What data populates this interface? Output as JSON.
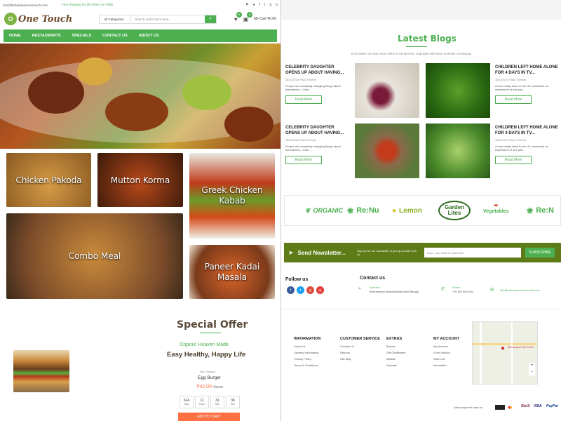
{
  "topbar": {
    "email": "info@behrampoieonetouch.com",
    "shipping": "Free Shipping for all Orders on ₹999"
  },
  "header": {
    "logo_small": "Behrampore",
    "logo_text": "One Touch",
    "search_category": "All Categories",
    "search_placeholder": "Search entire store here...",
    "wishlist_count": "0",
    "cart_count": "0",
    "cart_label": "My Cart ₹0.00"
  },
  "nav": [
    "HOME",
    "RESTAURANTS",
    "SPECIALS",
    "CONTACT US",
    "ABOUT US"
  ],
  "tiles": [
    "Chicken Pakoda",
    "Mutton Korma",
    "Greek Chicken Kabab",
    "Combo Meal",
    "Paneer Kadai Masala"
  ],
  "special": {
    "title": "Special Offer",
    "subtitle": "Organic Heaven Made",
    "tagline": "Easy Healthy, Happy Life",
    "category": "Hot Chicken",
    "product": "Egg Burger",
    "price": "₹42.00",
    "old_price": "₹62.00",
    "countdown": [
      {
        "v": "624",
        "l": "Day"
      },
      {
        "v": "11",
        "l": "Hour"
      },
      {
        "v": "31",
        "l": "Min"
      },
      {
        "v": "36",
        "l": "Sec"
      }
    ],
    "cta": "ADD TO CART"
  },
  "blogs": {
    "title": "Latest Blogs",
    "subtitle": "Duis autem vel eum iriure dolor in hendrerit in vulputate velit esse molestie consequat.",
    "posts": [
      {
        "title": "CELEBRITY DAUGHTER OPENS UP ABOUT HAVING...",
        "date": "18/10/2019",
        "author": "Plaza Themes",
        "excerpt": "People are constantly changing things about themselves— from...",
        "cta": "Read More"
      },
      {
        "title": "CHILDREN LEFT HOME ALONE FOR 4 DAYS IN TV...",
        "date": "18/10/2019",
        "author": "Plaza Themes",
        "excerpt": "A new reality show in the UK conducted an experiment to see just...",
        "cta": "Read More"
      },
      {
        "title": "CELEBRITY DAUGHTER OPENS UP ABOUT HAVING...",
        "date": "18/10/2019",
        "author": "Plaza Themes",
        "excerpt": "People are constantly changing things about themselves— from...",
        "cta": "Read More"
      },
      {
        "title": "CHILDREN LEFT HOME ALONE FOR 4 DAYS IN TV...",
        "date": "18/10/2019",
        "author": "Plaza Themes",
        "excerpt": "A new reality show in the UK conducted an experiment to see just...",
        "cta": "Read More"
      }
    ]
  },
  "brands": [
    "ORGANIC",
    "Re:Nu",
    "Lemon",
    "Garden Lites",
    "Vegetables",
    "Re:N"
  ],
  "newsletter": {
    "title": "Send Newsletter...",
    "desc": "Sign up for our newsletter to get up-to-date from us",
    "placeholder": "Enter your email to subscribe",
    "button": "SUBSCRIBE"
  },
  "follow": {
    "title": "Follow us",
    "contact_title": "Contact us",
    "address_label": "Address",
    "address": "Behrampore,Murshidabad,West Bengal",
    "phone_label": "Phone",
    "phone": "+91 9073411200",
    "email": "info@behrampoieonetouch.com"
  },
  "footer": {
    "cols": [
      {
        "title": "INFORMATION",
        "items": [
          "About Us",
          "Delivery Information",
          "Privacy Policy",
          "Terms & Conditions"
        ]
      },
      {
        "title": "CUSTOMER SERVICE",
        "items": [
          "Contact Us",
          "Returns",
          "Site Map"
        ]
      },
      {
        "title": "EXTRAS",
        "items": [
          "Brands",
          "Gift Certificates",
          "Affiliate",
          "Specials"
        ]
      },
      {
        "title": "MY ACCOUNT",
        "items": [
          "My Account",
          "Order History",
          "Wish List",
          "Newsletter"
        ]
      }
    ],
    "map_label": "Behrampore One Touch",
    "pay_label": "Allow payment base on",
    "pay_methods": [
      "VISA",
      "PayPal",
      "Skrill"
    ]
  },
  "colors": {
    "accent": "#4caf50",
    "newsletter": "#5d7b17",
    "cta": "#ff7043"
  }
}
